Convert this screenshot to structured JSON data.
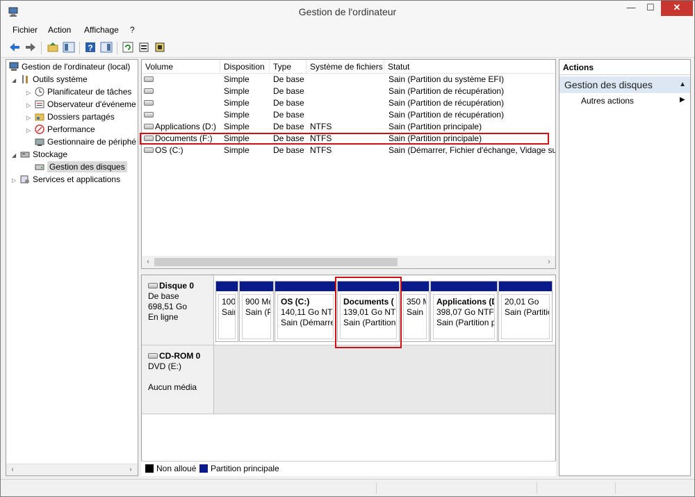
{
  "window": {
    "title": "Gestion de l'ordinateur",
    "minimize": "—",
    "maximize": "☐",
    "close": "✕"
  },
  "menu": [
    "Fichier",
    "Action",
    "Affichage",
    "?"
  ],
  "tree": {
    "root": "Gestion de l'ordinateur (local)",
    "items": [
      {
        "label": "Outils système"
      },
      {
        "label": "Planificateur de tâches"
      },
      {
        "label": "Observateur d'événeme"
      },
      {
        "label": "Dossiers partagés"
      },
      {
        "label": "Performance"
      },
      {
        "label": "Gestionnaire de périphé"
      },
      {
        "label": "Stockage"
      },
      {
        "label": "Gestion des disques"
      },
      {
        "label": "Services et applications"
      }
    ]
  },
  "volumes": {
    "columns": [
      "Volume",
      "Disposition",
      "Type",
      "Système de fichiers",
      "Statut"
    ],
    "rows": [
      {
        "volume": "",
        "layout": "Simple",
        "type": "De base",
        "fs": "",
        "status": "Sain (Partition du système EFI)"
      },
      {
        "volume": "",
        "layout": "Simple",
        "type": "De base",
        "fs": "",
        "status": "Sain (Partition de récupération)"
      },
      {
        "volume": "",
        "layout": "Simple",
        "type": "De base",
        "fs": "",
        "status": "Sain (Partition de récupération)"
      },
      {
        "volume": "",
        "layout": "Simple",
        "type": "De base",
        "fs": "",
        "status": "Sain (Partition de récupération)"
      },
      {
        "volume": "Applications (D:)",
        "layout": "Simple",
        "type": "De base",
        "fs": "NTFS",
        "status": "Sain (Partition principale)"
      },
      {
        "volume": "Documents (F:)",
        "layout": "Simple",
        "type": "De base",
        "fs": "NTFS",
        "status": "Sain (Partition principale)"
      },
      {
        "volume": "OS (C:)",
        "layout": "Simple",
        "type": "De base",
        "fs": "NTFS",
        "status": "Sain (Démarrer, Fichier d'échange, Vidage sur"
      }
    ]
  },
  "disk0": {
    "name": "Disque 0",
    "type": "De base",
    "size": "698,51 Go",
    "state": "En ligne",
    "partitions": [
      {
        "title": "",
        "size": "100",
        "status": "Sain"
      },
      {
        "title": "",
        "size": "900 Mo",
        "status": "Sain (P"
      },
      {
        "title": "OS  (C:)",
        "size": "140,11 Go NTFS",
        "status": "Sain (Démarre"
      },
      {
        "title": "Documents  (",
        "size": "139,01 Go NTF",
        "status": "Sain (Partition"
      },
      {
        "title": "",
        "size": "350 M",
        "status": "Sain ("
      },
      {
        "title": "Applications  (D",
        "size": "398,07 Go NTFS",
        "status": "Sain (Partition p"
      },
      {
        "title": "",
        "size": "20,01 Go",
        "status": "Sain (Partitic"
      }
    ]
  },
  "cdrom": {
    "name": "CD-ROM 0",
    "drive": "DVD (E:)",
    "media": "Aucun média"
  },
  "legend": [
    {
      "label": "Non alloué",
      "color": "#000000"
    },
    {
      "label": "Partition principale",
      "color": "#0a1a8a"
    }
  ],
  "actions": {
    "header": "Actions",
    "section": "Gestion des disques",
    "more": "Autres actions"
  }
}
